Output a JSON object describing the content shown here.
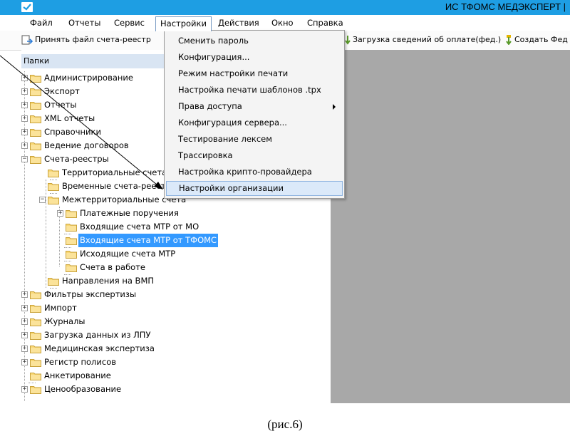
{
  "window": {
    "title": "ИС ТФОМС МЕДЭКСПЕРТ |",
    "app_icon": "app-logo-icon"
  },
  "menubar": {
    "items": [
      {
        "label": "Файл"
      },
      {
        "label": "Отчеты"
      },
      {
        "label": "Сервис"
      },
      {
        "label": "Настройки",
        "active": true
      },
      {
        "label": "Действия"
      },
      {
        "label": "Окно"
      },
      {
        "label": "Справка"
      }
    ]
  },
  "toolbar": {
    "accept_file_label": "Принять файл счета-реестр",
    "payment_info_label": "Загрузка сведений об оплате(фед.)",
    "create_label": "Создать Фед"
  },
  "settings_menu": {
    "items": [
      {
        "label": "Сменить пароль"
      },
      {
        "label": "Конфигурация..."
      },
      {
        "label": "Режим настройки печати"
      },
      {
        "label": "Настройка печати шаблонов .tpx"
      },
      {
        "label": "Права доступа",
        "submenu": true
      },
      {
        "label": "Конфигурация сервера..."
      },
      {
        "label": "Тестирование лексем"
      },
      {
        "label": "Трассировка"
      },
      {
        "label": "Настройка крипто-провайдера"
      },
      {
        "label": "Настройки организации",
        "highlighted": true
      }
    ]
  },
  "folders_panel": {
    "header": "Папки",
    "nodes": [
      {
        "label": "Администрирование",
        "expander": "+"
      },
      {
        "label": "Экспорт",
        "expander": "+"
      },
      {
        "label": "Отчеты",
        "expander": "+"
      },
      {
        "label": "XML отчеты",
        "expander": "+"
      },
      {
        "label": "Справочники",
        "expander": "+"
      },
      {
        "label": "Ведение договоров",
        "expander": "+"
      },
      {
        "label": "Счета-реестры",
        "expander": "−"
      },
      {
        "label": "Территориальные счета",
        "expander": ""
      },
      {
        "label": "Временные счета-реестры",
        "expander": ""
      },
      {
        "label": "Межтерриториальные счета",
        "expander": "−"
      },
      {
        "label": "Платежные поручения",
        "expander": "+"
      },
      {
        "label": "Входящие счета МТР от МО",
        "expander": ""
      },
      {
        "label": "Входящие счета МТР от ТФОМС",
        "expander": "",
        "selected": true
      },
      {
        "label": "Исходящие счета МТР",
        "expander": ""
      },
      {
        "label": "Счета в работе",
        "expander": ""
      },
      {
        "label": "Направления на ВМП",
        "expander": ""
      },
      {
        "label": "Фильтры экспертизы",
        "expander": "+"
      },
      {
        "label": "Импорт",
        "expander": "+"
      },
      {
        "label": "Журналы",
        "expander": "+"
      },
      {
        "label": "Загрузка данных из ЛПУ",
        "expander": "+"
      },
      {
        "label": "Медицинская экспертиза",
        "expander": "+"
      },
      {
        "label": "Регистр полисов",
        "expander": "+"
      },
      {
        "label": "Анкетирование",
        "expander": ""
      },
      {
        "label": "Ценообразование",
        "expander": "+"
      }
    ]
  },
  "caption": "(рис.6)",
  "colors": {
    "titlebar": "#1e9ee3",
    "selection": "#3399ff",
    "workspace": "#a8a8a8",
    "panel_header": "#d9e5f3"
  }
}
